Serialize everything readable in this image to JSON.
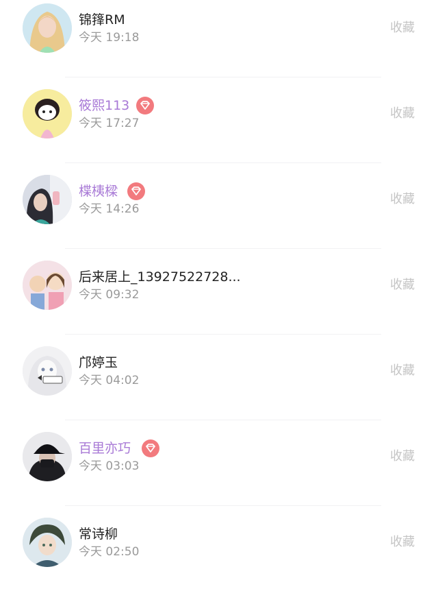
{
  "collect_label": "收藏",
  "colors": {
    "vip_name": "#a879d6",
    "vip_badge": "#f27a7e",
    "time": "#9a9a9a",
    "collect": "#c4c4c4"
  },
  "items": [
    {
      "name": "锦箨RM",
      "time": "今天 19:18",
      "vip": false,
      "avatar_icon": "avatar-woman-blonde-icon"
    },
    {
      "name": "筱熙113",
      "time": "今天 17:27",
      "vip": true,
      "avatar_icon": "avatar-cartoon-girl-icon"
    },
    {
      "name": "楪桋樑",
      "time": "今天 14:26",
      "vip": true,
      "avatar_icon": "avatar-girl-photo-icon"
    },
    {
      "name": "后来居上_13927522728...",
      "time": "今天 09:32",
      "vip": false,
      "avatar_icon": "avatar-cartoon-couple-icon"
    },
    {
      "name": "邝婷玉",
      "time": "今天 04:02",
      "vip": false,
      "avatar_icon": "avatar-white-girl-icon"
    },
    {
      "name": "百里亦巧",
      "time": "今天 03:03",
      "vip": true,
      "avatar_icon": "avatar-cap-person-icon"
    },
    {
      "name": "常诗柳",
      "time": "今天 02:50",
      "vip": false,
      "avatar_icon": "avatar-anime-boy-icon"
    }
  ]
}
